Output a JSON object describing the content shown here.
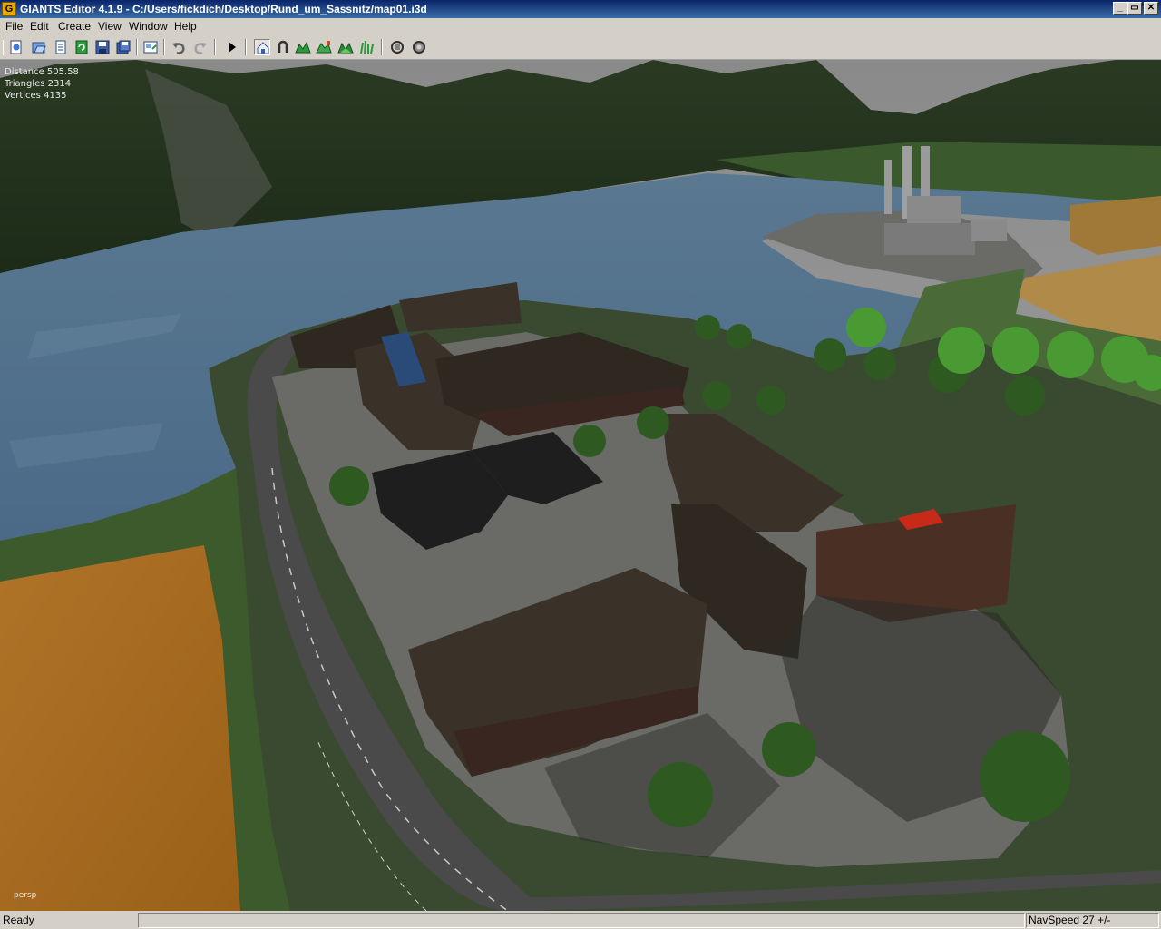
{
  "window": {
    "app_icon_letter": "G",
    "title": "GIANTS Editor 4.1.9 - C:/Users/fickdich/Desktop/Rund_um_Sassnitz/map01.i3d",
    "minimize": "_",
    "restore": "▭",
    "close": "✕"
  },
  "menu": [
    "File",
    "Edit",
    "Create",
    "View",
    "Window",
    "Help"
  ],
  "toolbar_icons": [
    "new-icon",
    "open-icon",
    "import-icon",
    "refresh-icon",
    "save-icon",
    "save-all-icon",
    "export-icon",
    "undo-icon",
    "redo-icon",
    "play-icon",
    "home-select-icon",
    "move-icon",
    "terrain-sculpt-icon",
    "terrain-paint-icon",
    "foliage-paint-icon",
    "grass-paint-icon",
    "object-place-icon",
    "settings-icon"
  ],
  "viewport": {
    "stats": [
      {
        "label": "Distance",
        "value": "505.58"
      },
      {
        "label": "Triangles",
        "value": "2314"
      },
      {
        "label": "Vertices",
        "value": "4135"
      }
    ],
    "camera": "persp"
  },
  "status": {
    "left": "Ready",
    "right": "NavSpeed 27 +/-"
  }
}
